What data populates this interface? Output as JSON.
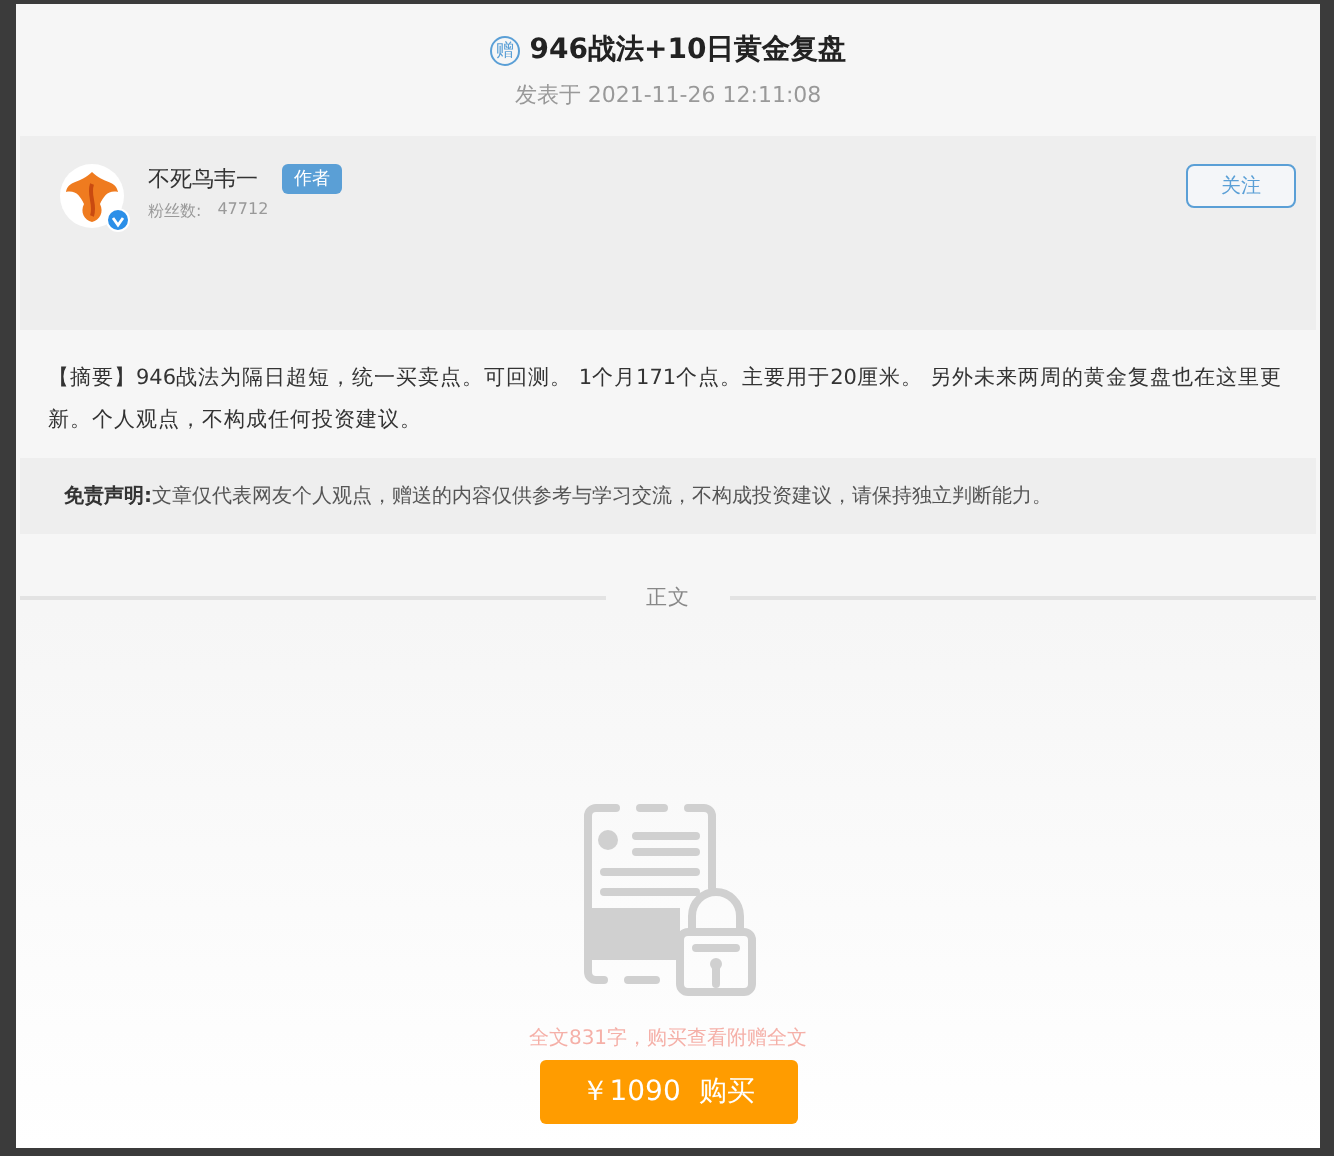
{
  "article": {
    "badge": "赠",
    "title": "946战法+10日黄金复盘",
    "published": "发表于 2021-11-26 12:11:08"
  },
  "author": {
    "name": "不死鸟韦一",
    "role": "作者",
    "followers_label": "粉丝数:",
    "followers": "47712",
    "verified": true,
    "follow_button": "关注"
  },
  "summary": {
    "label": "【摘要】",
    "text": "946战法为隔日超短，统一买卖点。可回测。 1个月171个点。主要用于20厘米。 另外未来两周的黄金复盘也在这里更新。个人观点，不构成任何投资建议。"
  },
  "disclaimer": {
    "label": "免责声明:",
    "text": "文章仅代表网友个人观点，赠送的内容仅供参考与学习交流，不构成投资建议，请保持独立判断能力。"
  },
  "divider": "正文",
  "paywall": {
    "notice": "全文831字，购买查看附赠全文",
    "button": "￥1090  购买"
  }
}
